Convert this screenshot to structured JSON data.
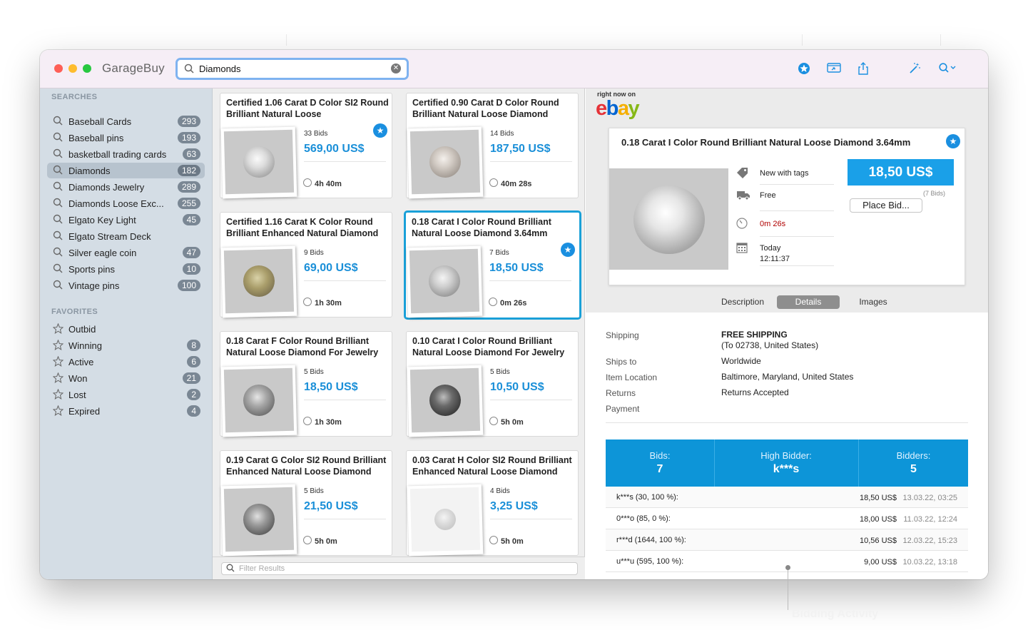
{
  "app": {
    "title": "GarageBuy"
  },
  "search": {
    "value": "Diamonds"
  },
  "sidebar": {
    "searches_header": "SEARCHES",
    "searches": [
      {
        "label": "Baseball Cards",
        "count": "293"
      },
      {
        "label": "Baseball pins",
        "count": "193"
      },
      {
        "label": "basketball trading cards",
        "count": "63"
      },
      {
        "label": "Diamonds",
        "count": "182"
      },
      {
        "label": "Diamonds Jewelry",
        "count": "289"
      },
      {
        "label": "Diamonds Loose Exc...",
        "count": "255"
      },
      {
        "label": "Elgato Key Light",
        "count": "45"
      },
      {
        "label": "Elgato Stream Deck",
        "count": ""
      },
      {
        "label": "Silver eagle coin",
        "count": "47"
      },
      {
        "label": "Sports pins",
        "count": "10"
      },
      {
        "label": "Vintage pins",
        "count": "100"
      }
    ],
    "favorites_header": "FAVORITES",
    "favorites": [
      {
        "label": "Outbid",
        "count": ""
      },
      {
        "label": "Winning",
        "count": "8"
      },
      {
        "label": "Active",
        "count": "6"
      },
      {
        "label": "Won",
        "count": "21"
      },
      {
        "label": "Lost",
        "count": "2"
      },
      {
        "label": "Expired",
        "count": "4"
      }
    ]
  },
  "listings": [
    {
      "title": "Certified 1.06 Carat D Color SI2 Round Brilliant Natural Loose",
      "bids": "33 Bids",
      "price": "569,00 US$",
      "time": "4h 40m",
      "starred": true
    },
    {
      "title": "Certified 0.90 Carat D Color Round Brilliant Natural Loose Diamond",
      "bids": "14 Bids",
      "price": "187,50 US$",
      "time": "40m 28s",
      "starred": false
    },
    {
      "title": "Certified 1.16 Carat K Color Round Brilliant Enhanced Natural Diamond",
      "bids": "9 Bids",
      "price": "69,00 US$",
      "time": "1h 30m",
      "starred": false
    },
    {
      "title": "0.18 Carat I Color Round Brilliant Natural Loose Diamond 3.64mm",
      "bids": "7 Bids",
      "price": "18,50 US$",
      "time": "0m 26s",
      "starred": true
    },
    {
      "title": "0.18 Carat F Color Round Brilliant Natural Loose Diamond For Jewelry",
      "bids": "5 Bids",
      "price": "18,50 US$",
      "time": "1h 30m",
      "starred": false
    },
    {
      "title": "0.10 Carat I Color Round Brilliant Natural Loose Diamond For Jewelry",
      "bids": "5 Bids",
      "price": "10,50 US$",
      "time": "5h 0m",
      "starred": false
    },
    {
      "title": "0.19 Carat G Color SI2 Round Brilliant Enhanced Natural Loose Diamond",
      "bids": "5 Bids",
      "price": "21,50 US$",
      "time": "5h 0m",
      "starred": false
    },
    {
      "title": "0.03 Carat H Color SI2 Round Brilliant Enhanced Natural Loose Diamond",
      "bids": "4 Bids",
      "price": "3,25 US$",
      "time": "5h 0m",
      "starred": false
    }
  ],
  "filter": {
    "placeholder": "Filter Results"
  },
  "detail": {
    "right_now_on": "right now on",
    "marketplace": "ebay",
    "title": "0.18 Carat I Color Round Brilliant Natural Loose Diamond 3.64mm",
    "condition": "New with tags",
    "shipping_cost": "Free",
    "time_left": "0m 26s",
    "end_day": "Today",
    "end_time": "12:11:37",
    "price": "18,50 US$",
    "bid_count": "(7 Bids)",
    "place_bid": "Place Bid...",
    "tabs": [
      "Description",
      "Details",
      "Images"
    ],
    "info": [
      {
        "label": "Shipping",
        "value": "FREE SHIPPING",
        "value2": "(To 02738, United States)"
      },
      {
        "label": "Ships to",
        "value": "Worldwide",
        "value2": ""
      },
      {
        "label": "Item Location",
        "value": "Baltimore, Maryland, United States",
        "value2": ""
      },
      {
        "label": "Returns",
        "value": "Returns Accepted",
        "value2": ""
      },
      {
        "label": "Payment",
        "value": "",
        "value2": ""
      }
    ],
    "bid_summary": {
      "bids_label": "Bids:",
      "bids_value": "7",
      "high_label": "High Bidder:",
      "high_value": "k***s",
      "bidders_label": "Bidders:",
      "bidders_value": "5"
    },
    "bid_history": [
      {
        "user": "k***s (30, 100 %):",
        "amount": "18,50 US$",
        "date": "13.03.22, 03:25"
      },
      {
        "user": "0***o (85, 0 %):",
        "amount": "18,00 US$",
        "date": "11.03.22, 12:24"
      },
      {
        "user": "r***d (1644, 100 %):",
        "amount": "10,56 US$",
        "date": "12.03.22, 15:23"
      },
      {
        "user": "u***u (595, 100 %):",
        "amount": "9,00 US$",
        "date": "10.03.22, 13:18"
      }
    ]
  },
  "callout": {
    "label": "Bidding Activity"
  },
  "colors": {
    "accent": "#1a8fe0",
    "sidebar": "#d4dde5",
    "bid_panel": "#0d95d8"
  }
}
